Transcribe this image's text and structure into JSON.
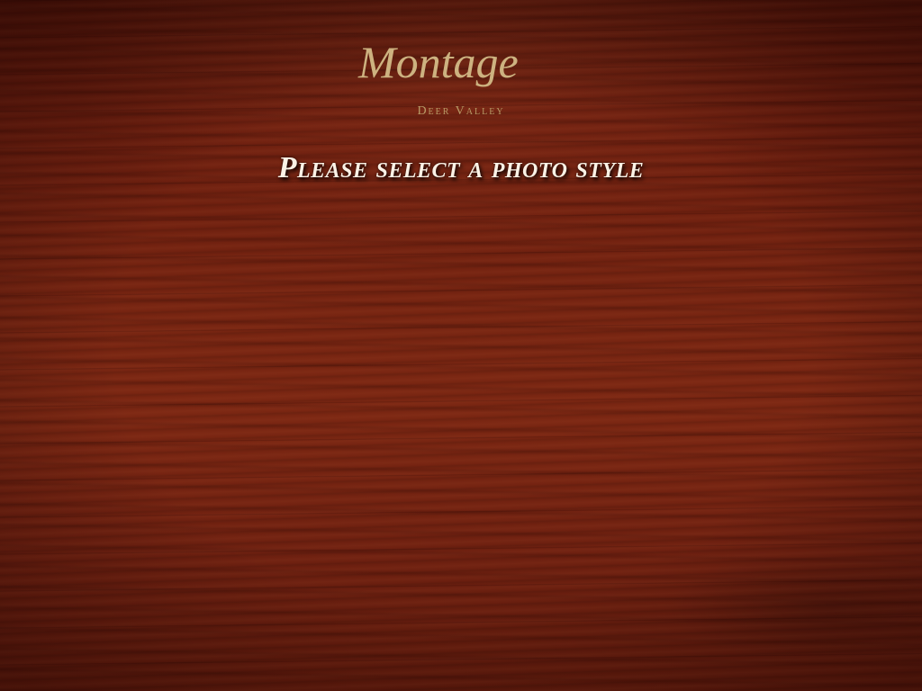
{
  "brand": {
    "name": "Montage",
    "location": "Deer Valley",
    "gold_color": "#cdb280"
  },
  "prompt": {
    "title": "Please select a photo style"
  },
  "background": {
    "style": "mahogany wood grain",
    "base_color": "#762411"
  }
}
